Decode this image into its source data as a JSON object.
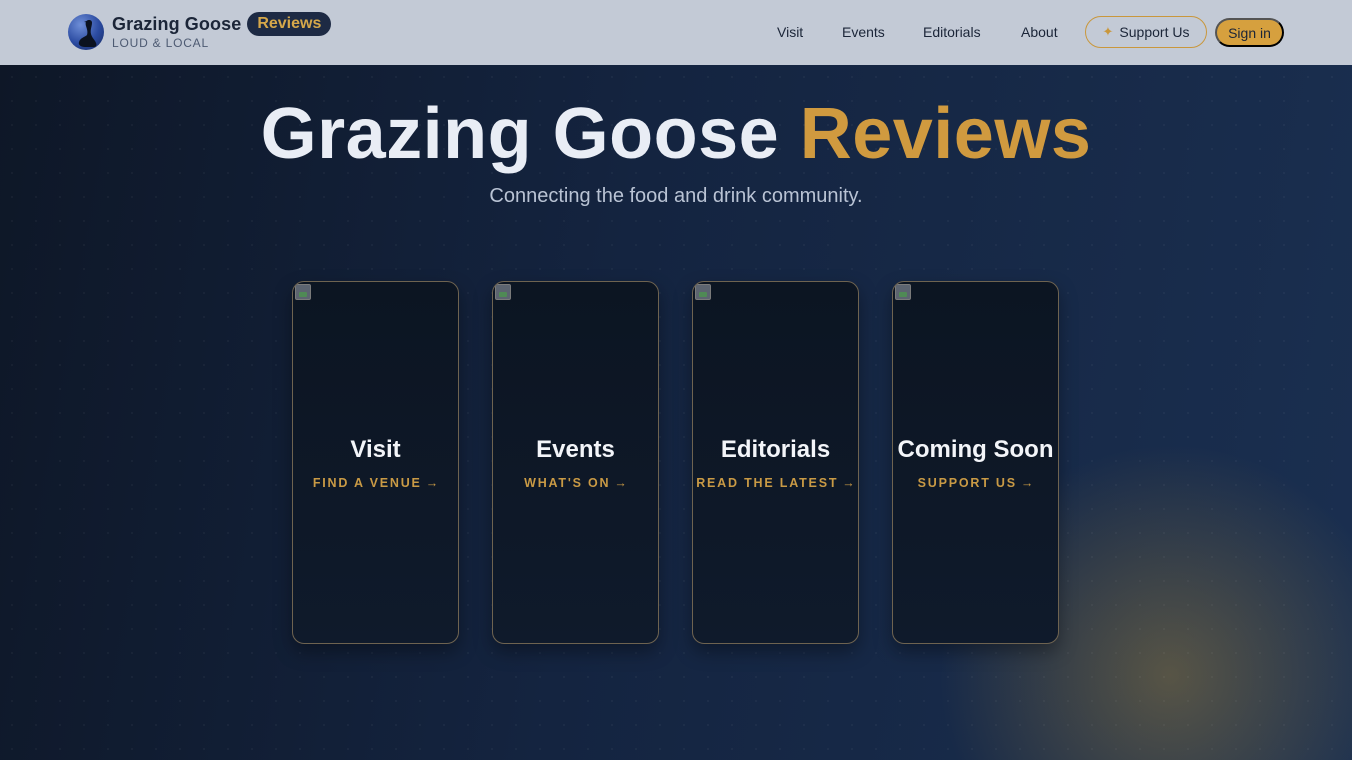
{
  "brand": {
    "name": "Grazing Goose",
    "pill": "Reviews",
    "tagline": "LOUD & LOCAL",
    "logo_icon": "goose-icon"
  },
  "nav": {
    "links": [
      "Visit",
      "Events",
      "Editorials",
      "About"
    ],
    "support_label": "Support Us",
    "support_icon": "sparkle-icon",
    "signin_label": "Sign in"
  },
  "hero": {
    "title_main": "Grazing Goose",
    "title_accent": "Reviews",
    "subtitle": "Connecting the food and drink community."
  },
  "cards": [
    {
      "title": "Visit",
      "cta": "FIND A VENUE"
    },
    {
      "title": "Events",
      "cta": "WHAT'S ON"
    },
    {
      "title": "Editorials",
      "cta": "READ THE LATEST"
    },
    {
      "title": "Coming Soon",
      "cta": "SUPPORT US"
    }
  ],
  "icons": {
    "arrow": "→",
    "sparkle": "✦"
  },
  "colors": {
    "accent": "#d09a3f",
    "header_bg": "#c3cad6",
    "hero_bg": "#142440"
  }
}
